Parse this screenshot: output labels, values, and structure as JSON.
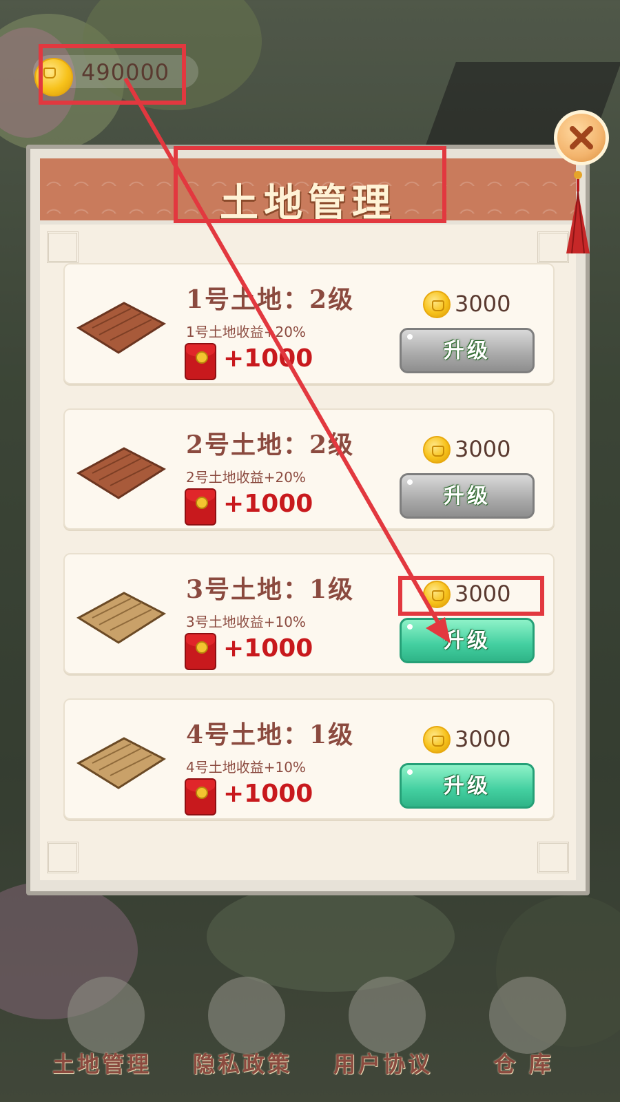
{
  "header": {
    "coin_balance": "490000"
  },
  "panel": {
    "title": "土地管理"
  },
  "lands": [
    {
      "title": "1号土地：2级",
      "bonus": "1号土地收益+20%",
      "reward": "+1000",
      "cost": "3000",
      "button_label": "升级",
      "button_state": "disabled"
    },
    {
      "title": "2号土地：2级",
      "bonus": "2号土地收益+20%",
      "reward": "+1000",
      "cost": "3000",
      "button_label": "升级",
      "button_state": "disabled"
    },
    {
      "title": "3号土地：1级",
      "bonus": "3号土地收益+10%",
      "reward": "+1000",
      "cost": "3000",
      "button_label": "升级",
      "button_state": "active"
    },
    {
      "title": "4号土地：1级",
      "bonus": "4号土地收益+10%",
      "reward": "+1000",
      "cost": "3000",
      "button_label": "升级",
      "button_state": "active"
    }
  ],
  "bottom_nav": [
    {
      "label": "土地管理",
      "icon": "gate-icon"
    },
    {
      "label": "隐私政策",
      "icon": "scroll-icon"
    },
    {
      "label": "用户协议",
      "icon": "counter-icon"
    },
    {
      "label": "仓 库",
      "icon": "warehouse-icon"
    }
  ],
  "colors": {
    "annotation": "#e2383f",
    "button_active": "#43cfa0",
    "button_disabled": "#a9a9a9",
    "title_brown": "#8b4a3f",
    "reward_red": "#c8191d"
  }
}
